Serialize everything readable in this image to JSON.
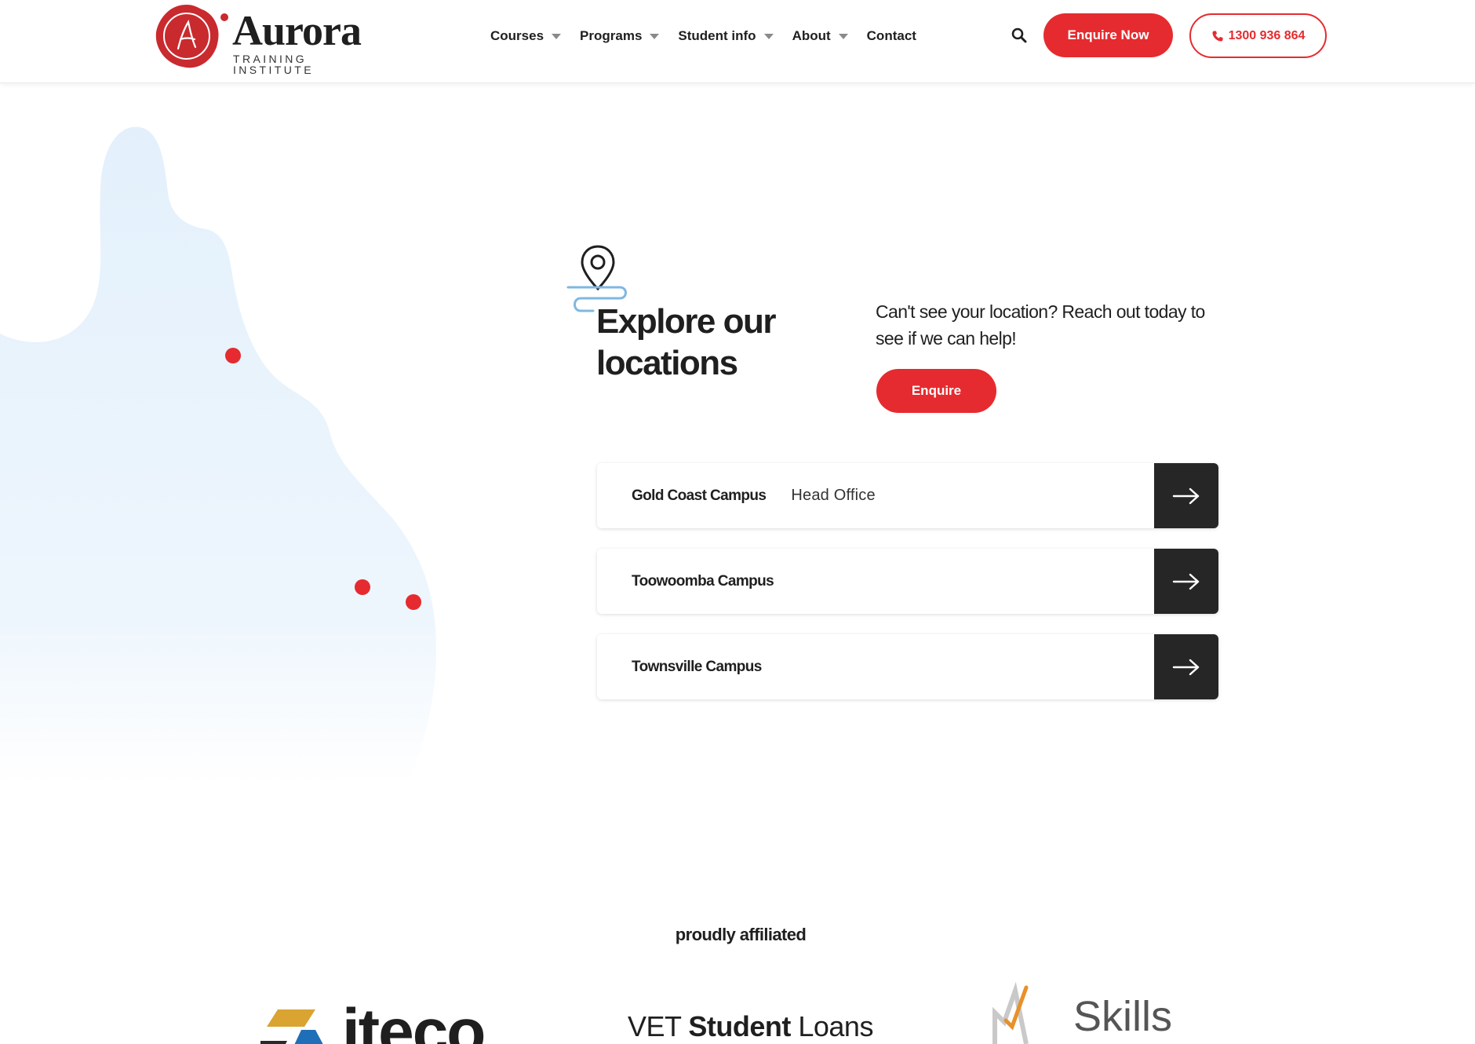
{
  "brand": {
    "name": "Aurora",
    "tagline": "TRAINING INSTITUTE",
    "seal_letter": "A",
    "accent_color": "#e52b2f",
    "dark_color": "#262626"
  },
  "nav": {
    "items": [
      {
        "label": "Courses",
        "has_dropdown": true
      },
      {
        "label": "Programs",
        "has_dropdown": true
      },
      {
        "label": "Student info",
        "has_dropdown": true
      },
      {
        "label": "About",
        "has_dropdown": true
      },
      {
        "label": "Contact",
        "has_dropdown": false
      }
    ],
    "search_icon": "search-icon",
    "enquire_now_label": "Enquire Now",
    "phone_icon": "phone-icon",
    "phone_label": "1300 936 864"
  },
  "locations": {
    "icon": "map-pin-icon",
    "title": "Explore our locations",
    "intro": "Can't see your location? Reach out today to see if we can help!",
    "enquire_label": "Enquire",
    "campuses": [
      {
        "name": "Gold Coast Campus",
        "tag": "Head Office"
      },
      {
        "name": "Toowoomba Campus",
        "tag": ""
      },
      {
        "name": "Townsville Campus",
        "tag": ""
      }
    ],
    "arrow_icon": "arrow-right-icon"
  },
  "affiliates": {
    "title": "proudly affiliated",
    "logos": [
      {
        "text": "iteco"
      },
      {
        "text_light": "VET ",
        "text_bold": "Student",
        "text_light2": " Loans"
      },
      {
        "text": "Skills"
      }
    ]
  }
}
